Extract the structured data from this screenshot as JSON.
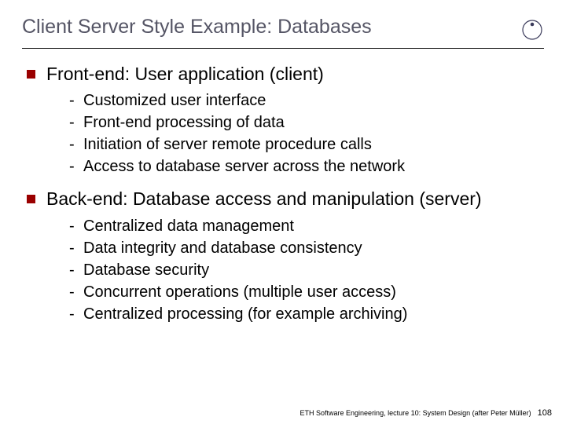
{
  "title": "Client Server Style Example: Databases",
  "sections": [
    {
      "heading": "Front-end: User application (client)",
      "items": [
        "Customized user interface",
        "Front-end processing of data",
        "Initiation of server remote procedure calls",
        "Access to database server across the network"
      ]
    },
    {
      "heading": "Back-end: Database access and manipulation (server)",
      "items": [
        "Centralized data management",
        "Data integrity and database consistency",
        "Database security",
        "Concurrent operations (multiple user access)",
        "Centralized processing (for example archiving)"
      ]
    }
  ],
  "footer": {
    "text": "ETH Software Engineering, lecture 10: System Design (after Peter Müller)",
    "page": "108"
  }
}
